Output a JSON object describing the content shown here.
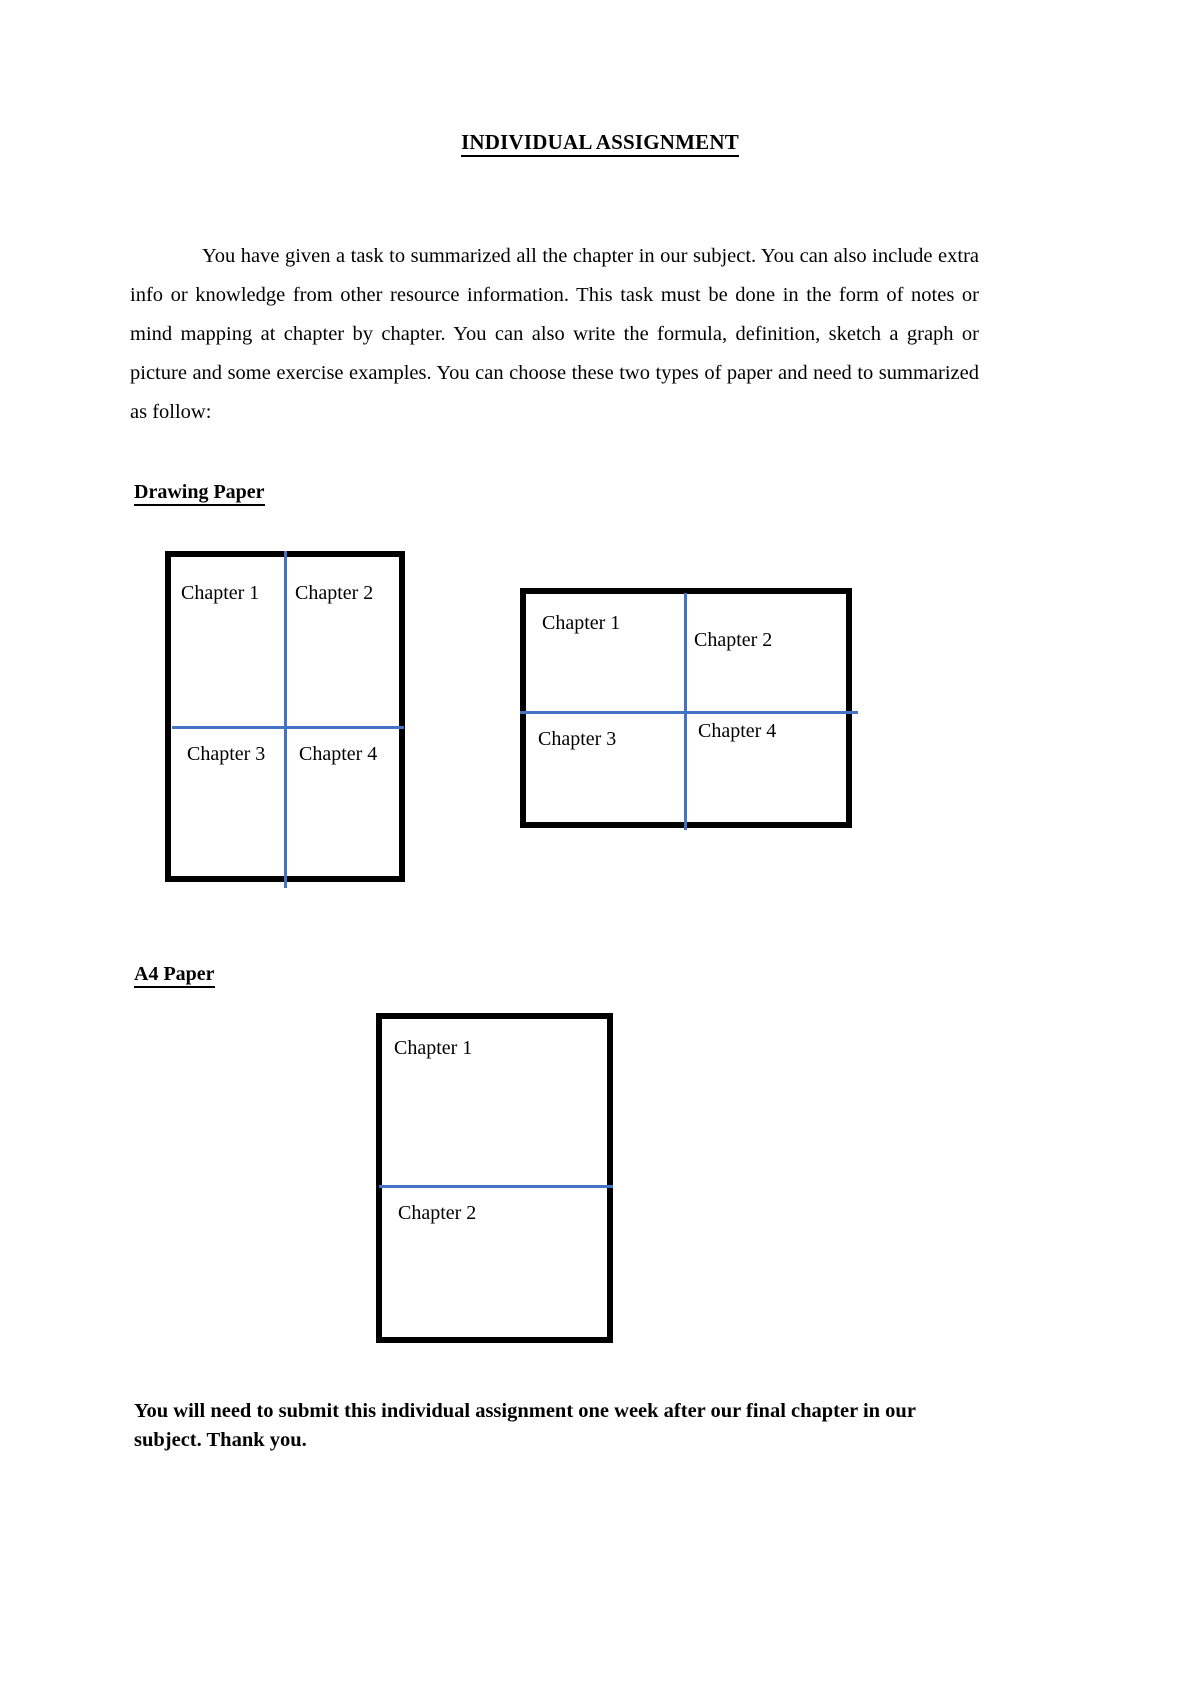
{
  "document": {
    "title": "INDIVIDUAL ASSIGNMENT",
    "intro_paragraph": "You have given a task to summarized all the chapter in our subject. You can also include extra info or knowledge from other resource information. This task must be done in the form of notes or mind mapping at chapter by chapter. You can also write the formula, definition, sketch a graph or picture and some exercise examples. You can choose these two types of paper and need to summarized as follow:",
    "closing_note": "You will need to submit this individual assignment one week after our final chapter in our subject. Thank you."
  },
  "sections": {
    "drawing_paper": {
      "heading": "Drawing Paper",
      "diagrams": {
        "portrait": {
          "orientation": "portrait",
          "cells": [
            "Chapter 1",
            "Chapter 2",
            "Chapter 3",
            "Chapter 4"
          ]
        },
        "landscape": {
          "orientation": "landscape",
          "cells": [
            "Chapter 1",
            "Chapter 2",
            "Chapter 3",
            "Chapter 4"
          ]
        }
      }
    },
    "a4_paper": {
      "heading": "A4 Paper",
      "diagrams": {
        "portrait": {
          "orientation": "portrait",
          "cells": [
            "Chapter 1",
            "Chapter 2"
          ]
        }
      }
    }
  },
  "colors": {
    "page_background": "#FFFFFF",
    "text": "#000000",
    "paper_border": "#000000",
    "divider_blue": "#4472C4"
  }
}
